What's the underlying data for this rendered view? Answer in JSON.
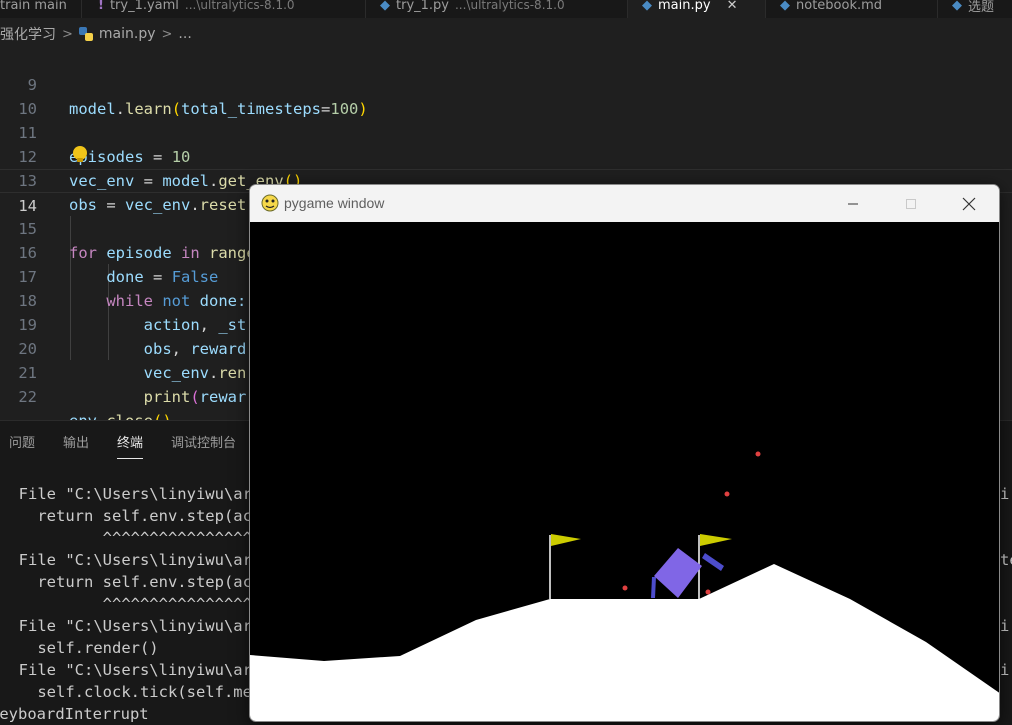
{
  "tabs": [
    {
      "name": "train main",
      "path": ""
    },
    {
      "name": "try_1.yaml",
      "path": "...\\ultralytics-8.1.0"
    },
    {
      "name": "try_1.py",
      "path": "...\\ultralytics-8.1.0"
    },
    {
      "name": "main.py",
      "path": ""
    },
    {
      "name": "notebook.md",
      "path": ""
    },
    {
      "name": "选题",
      "path": ""
    }
  ],
  "breadcrumb": {
    "folder": "强化学习",
    "file": "main.py",
    "more": "..."
  },
  "editor": {
    "line_numbers": [
      "9",
      "10",
      "11",
      "12",
      "13",
      "14",
      "15",
      "16",
      "17",
      "18",
      "19",
      "20",
      "21",
      "22"
    ],
    "current_line": "14"
  },
  "panel": {
    "tabs": [
      "问题",
      "输出",
      "终端",
      "调试控制台"
    ],
    "active_tab": "终端",
    "terminal_lines": [
      "  File \"C:\\Users\\linyiwu\\ar",
      "    return self.env.step(ac",
      "           ^^^^^^^^^^^^^^^^",
      "  File \"C:\\Users\\linyiwu\\ar",
      "    return self.env.step(ac",
      "           ^^^^^^^^^^^^^^^^",
      "  File \"C:\\Users\\linyiwu\\ar",
      "    self.render()",
      "  File \"C:\\Users\\linyiwu\\ar",
      "    self.clock.tick(self.me",
      "KeyboardInterrupt"
    ],
    "right_edge_fragments": [
      "ir",
      "te",
      "ir",
      "ir"
    ]
  },
  "pygame_window": {
    "title": "pygame window",
    "controls": [
      "minimize-icon",
      "maximize-icon",
      "close-icon"
    ]
  },
  "colors": {
    "editor_bg": "#1f1f1f",
    "panel_bg": "#181818",
    "terrain": "#ffffff",
    "lander_body": "#8066e6",
    "lander_legs": "#4d4dcc",
    "flag": "#cccc00",
    "particles": "#e04040"
  }
}
